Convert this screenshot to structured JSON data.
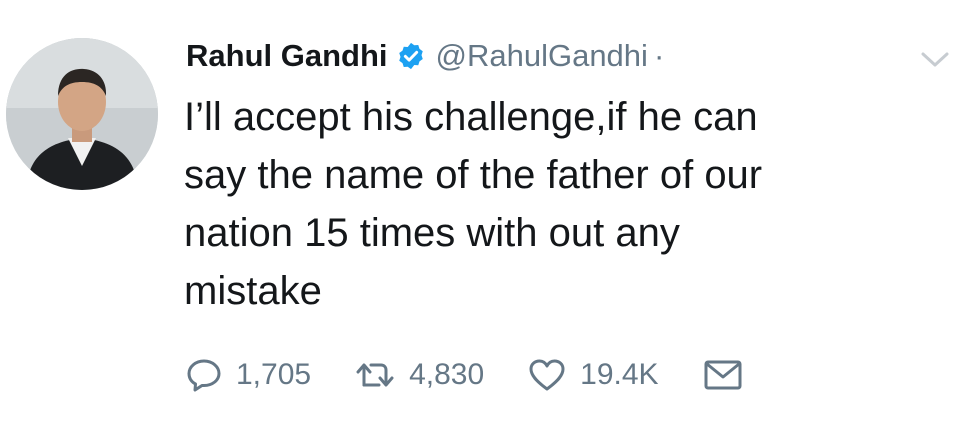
{
  "tweet": {
    "author": {
      "name": "Rahul Gandhi",
      "handle": "@RahulGandhi",
      "separator": "·",
      "verified_color": "#1da1f2"
    },
    "text_lines": [
      "I’ll accept his challenge,if he can",
      "say the name of the father of our",
      "nation 15 times with out any",
      "mistake"
    ],
    "actions": {
      "replies": "1,705",
      "retweets": "4,830",
      "likes": "19.4K"
    },
    "icons": {
      "reply": "reply-icon",
      "retweet": "retweet-icon",
      "like": "heart-icon",
      "message": "envelope-icon",
      "menu": "chevron-down-icon"
    },
    "colors": {
      "text": "#14171a",
      "secondary": "#657786"
    }
  }
}
